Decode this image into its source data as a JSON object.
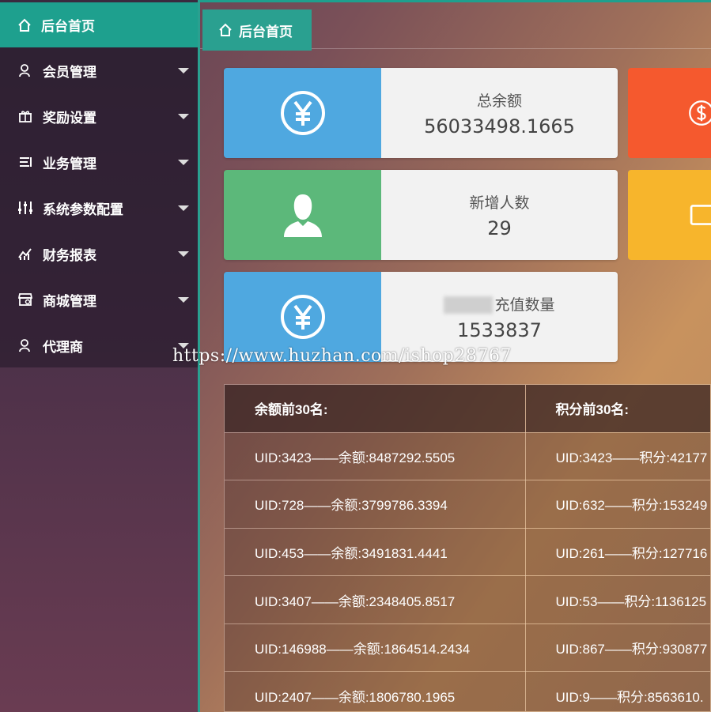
{
  "sidebar": {
    "home_label": "后台首页",
    "items": [
      {
        "label": "会员管理",
        "icon": "user-icon"
      },
      {
        "label": "奖励设置",
        "icon": "gift-icon"
      },
      {
        "label": "业务管理",
        "icon": "list-icon"
      },
      {
        "label": "系统参数配置",
        "icon": "sliders-icon"
      },
      {
        "label": "财务报表",
        "icon": "chart-icon"
      },
      {
        "label": "商城管理",
        "icon": "shop-icon"
      },
      {
        "label": "代理商",
        "icon": "user-icon"
      }
    ]
  },
  "topbar": {
    "tab_label": "后台首页"
  },
  "cards": {
    "total_balance": {
      "label": "总余额",
      "value": "56033498.1665",
      "color": "#4fa8e0"
    },
    "new_users": {
      "label": "新增人数",
      "value": "29",
      "color": "#5cb87a"
    },
    "recharge": {
      "label": "充值数量",
      "value": "1533837",
      "color": "#4fa8e0"
    }
  },
  "side_cards_colors": {
    "top": "#f5592e",
    "middle": "#f7b52c"
  },
  "table": {
    "headers": [
      "余额前30名:",
      "积分前30名:"
    ],
    "rows": [
      [
        "UID:3423——余额:8487292.5505",
        "UID:3423——积分:42177"
      ],
      [
        "UID:728——余额:3799786.3394",
        "UID:632——积分:153249"
      ],
      [
        "UID:453——余额:3491831.4441",
        "UID:261——积分:127716"
      ],
      [
        "UID:3407——余额:2348405.8517",
        "UID:53——积分:1136125"
      ],
      [
        "UID:146988——余额:1864514.2434",
        "UID:867——积分:930877"
      ],
      [
        "UID:2407——余额:1806780.1965",
        "UID:9——积分:8563610."
      ]
    ]
  },
  "watermark": "https://www.huzhan.com/ishop28767"
}
